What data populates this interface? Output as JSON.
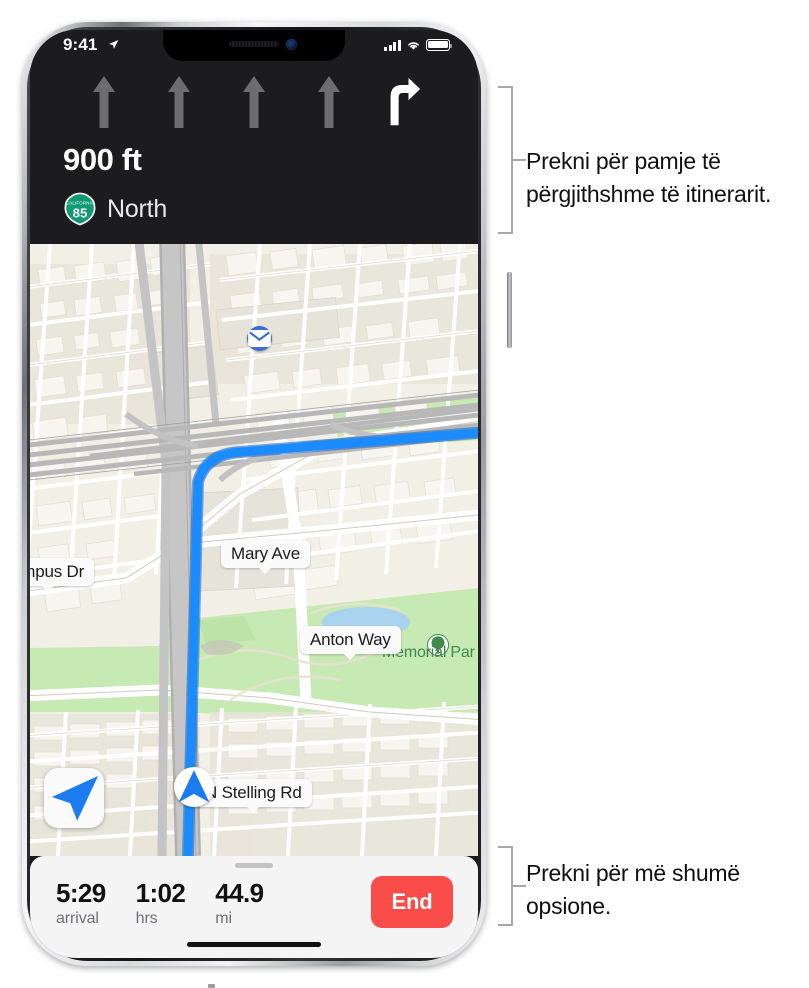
{
  "device": {
    "name": "iPhone X"
  },
  "status_bar": {
    "time": "9:41",
    "location_icon": "location-arrow-icon",
    "cellular_icon": "signal-bars-icon",
    "wifi_icon": "wifi-icon",
    "battery_icon": "battery-full-icon"
  },
  "nav_header": {
    "background_color": "#1c1c1e",
    "lanes": [
      {
        "type": "straight",
        "active": false,
        "color": "#6d6d70"
      },
      {
        "type": "straight",
        "active": false,
        "color": "#6d6d70"
      },
      {
        "type": "straight",
        "active": false,
        "color": "#6d6d70"
      },
      {
        "type": "straight",
        "active": false,
        "color": "#6d6d70"
      },
      {
        "type": "turn-right",
        "active": true,
        "color": "#ffffff"
      }
    ],
    "distance": "900 ft",
    "route_shield": {
      "state": "CALIFORNIA",
      "number": "85",
      "color": "#0f9b72"
    },
    "road_name": "North"
  },
  "map": {
    "labels": [
      {
        "name": "campus-dr",
        "text": "ampus Dr"
      },
      {
        "name": "mary-ave",
        "text": "Mary Ave"
      },
      {
        "name": "anton-way",
        "text": "Anton Way"
      },
      {
        "name": "n-stelling-rd",
        "text": "N Stelling Rd"
      }
    ],
    "park_label": "Memorial Par",
    "route_color": "#1a8cff",
    "puck_icon": "navigation-puck-icon",
    "poi_mail_icon": "mail-icon",
    "park_pin_icon": "park-tree-icon",
    "compass_button_icon": "location-arrow-icon",
    "land_color": "#f2efe6",
    "park_color": "#c7e9b4",
    "water_color": "#aad3f0",
    "road_color": "#ffffff",
    "highway_color": "#b5b5b5"
  },
  "bottom_sheet": {
    "grabber": "drag-handle",
    "stats": [
      {
        "name": "arrival",
        "value": "5:29",
        "unit": "arrival"
      },
      {
        "name": "duration",
        "value": "1:02",
        "unit": "hrs"
      },
      {
        "name": "distance",
        "value": "44.9",
        "unit": "mi"
      }
    ],
    "end_button": {
      "label": "End",
      "color": "#fa4d4a"
    }
  },
  "callouts": [
    {
      "name": "callout-route-overview",
      "text": "Prekni për pamje të përgjithshme të itinerarit."
    },
    {
      "name": "callout-more-options",
      "text": "Prekni për më shumë opsione."
    }
  ]
}
